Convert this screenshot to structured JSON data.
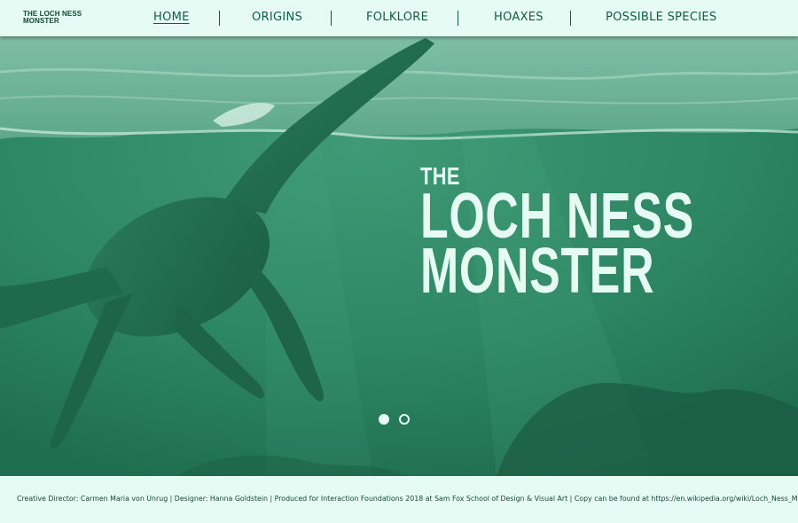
{
  "site": {
    "logo_line1": "THE LOCH NESS",
    "logo_line2": "MONSTER"
  },
  "nav": {
    "items": [
      {
        "label": "HOME",
        "active": true
      },
      {
        "label": "ORIGINS",
        "active": false
      },
      {
        "label": "FOLKLORE",
        "active": false
      },
      {
        "label": "HOAXES",
        "active": false
      },
      {
        "label": "POSSIBLE SPECIES",
        "active": false
      }
    ]
  },
  "hero": {
    "title_line1": "THE",
    "title_line2": "LOCH NESS",
    "title_line3": "MONSTER",
    "slides": [
      {
        "state": "active"
      },
      {
        "state": "inactive"
      }
    ]
  },
  "footer": {
    "credits": "Creative Director: Carmen Maria von Unrug | Designer: Hanna Goldstein | Produced for Interaction Foundations 2018 at Sam Fox School of Design & Visual Art | Copy can be found at https://en.wikipedia.org/wiki/Loch_Ness_Monster"
  },
  "colors": {
    "accent": "#0f5e43",
    "background": "#e6fbf4",
    "water": "#2f8b67"
  }
}
